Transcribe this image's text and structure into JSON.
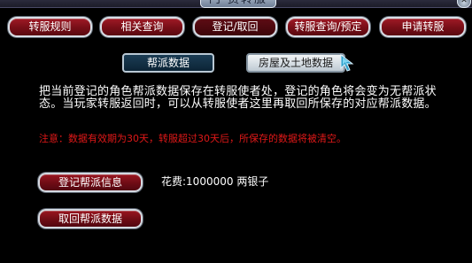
{
  "window": {
    "title": "门 费转服",
    "close_glyph": "✕"
  },
  "tabs": [
    {
      "label": "转服规则"
    },
    {
      "label": "相关查询"
    },
    {
      "label": "登记/取回"
    },
    {
      "label": "转服查询/预定"
    },
    {
      "label": "申请转服"
    }
  ],
  "subtabs": [
    {
      "label": "帮派数据"
    },
    {
      "label": "房屋及土地数据"
    }
  ],
  "description": "把当前登记的角色帮派数据保存在转服使者处，登记的角色将会变为无帮派状态。当玩家转服返回时，可以从转服使者这里再取回所保存的对应帮派数据。",
  "notice": "注意：数据有效期为30天，转服超过30天后，所保存的数据将被清空。",
  "actions": {
    "register_label": "登记帮派信息",
    "retrieve_label": "取回帮派数据"
  },
  "fee": {
    "label": "花费:",
    "amount": "1000000",
    "unit": "两银子"
  }
}
